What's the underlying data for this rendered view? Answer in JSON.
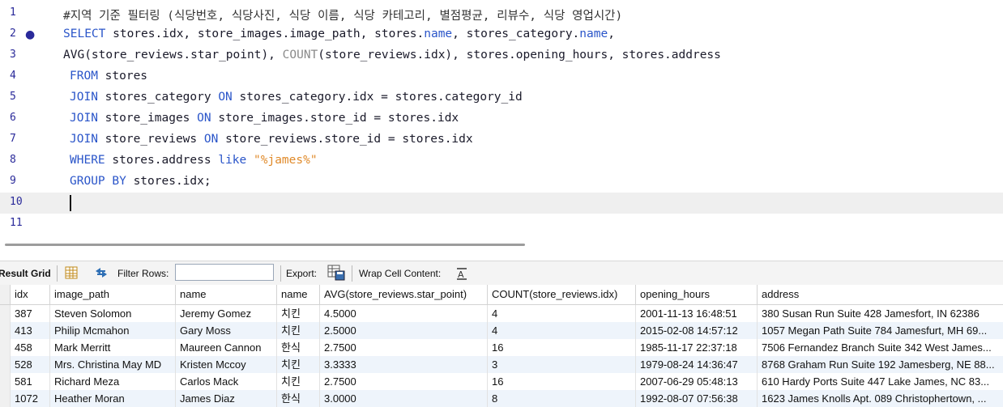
{
  "editor": {
    "lines": [
      {
        "num": "1",
        "tokens": [
          {
            "t": "#지역 기준 필터링 (식당번호, 식당사진, 식당 이름, 식당 카테고리, 별점평균, 리뷰수, 식당 영업시간)",
            "c": "cmt"
          }
        ],
        "indent": 78
      },
      {
        "num": "2",
        "tokens": [
          {
            "t": "SELECT",
            "c": "kw"
          },
          {
            "t": " stores.idx, store_images.image_path, stores.",
            "c": ""
          },
          {
            "t": "name",
            "c": "kw"
          },
          {
            "t": ", stores_category.",
            "c": ""
          },
          {
            "t": "name",
            "c": "kw"
          },
          {
            "t": ",",
            "c": ""
          }
        ],
        "indent": 78,
        "marker": "●"
      },
      {
        "num": "3",
        "tokens": [
          {
            "t": "AVG",
            "c": ""
          },
          {
            "t": "(store_reviews.star_point), ",
            "c": ""
          },
          {
            "t": "COUNT",
            "c": "fn"
          },
          {
            "t": "(store_reviews.idx), stores.opening_hours, stores.address",
            "c": ""
          }
        ],
        "indent": 78
      },
      {
        "num": "4",
        "tokens": [
          {
            "t": "FROM",
            "c": "kw"
          },
          {
            "t": " stores",
            "c": ""
          }
        ],
        "indent": 86
      },
      {
        "num": "5",
        "tokens": [
          {
            "t": "JOIN",
            "c": "kw"
          },
          {
            "t": " stores_category ",
            "c": ""
          },
          {
            "t": "ON",
            "c": "kw"
          },
          {
            "t": " stores_category.idx = stores.category_id",
            "c": ""
          }
        ],
        "indent": 86
      },
      {
        "num": "6",
        "tokens": [
          {
            "t": "JOIN",
            "c": "kw"
          },
          {
            "t": " store_images ",
            "c": ""
          },
          {
            "t": "ON",
            "c": "kw"
          },
          {
            "t": " store_images.store_id = stores.idx",
            "c": ""
          }
        ],
        "indent": 86
      },
      {
        "num": "7",
        "tokens": [
          {
            "t": "JOIN",
            "c": "kw"
          },
          {
            "t": " store_reviews ",
            "c": ""
          },
          {
            "t": "ON",
            "c": "kw"
          },
          {
            "t": " store_reviews.store_id = stores.idx",
            "c": ""
          }
        ],
        "indent": 86
      },
      {
        "num": "8",
        "tokens": [
          {
            "t": "WHERE",
            "c": "kw"
          },
          {
            "t": " stores.address ",
            "c": ""
          },
          {
            "t": "like",
            "c": "kw"
          },
          {
            "t": " ",
            "c": ""
          },
          {
            "t": "\"%james%\"",
            "c": "str"
          }
        ],
        "indent": 86
      },
      {
        "num": "9",
        "tokens": [
          {
            "t": "GROUP BY",
            "c": "kw"
          },
          {
            "t": " stores.idx;",
            "c": ""
          }
        ],
        "indent": 86
      },
      {
        "num": "10",
        "tokens": [],
        "indent": 86,
        "active": true
      },
      {
        "num": "11",
        "tokens": [],
        "indent": 86
      }
    ]
  },
  "toolbar": {
    "result_grid": "Result Grid",
    "filter_rows": "Filter Rows:",
    "filter_value": "",
    "export": "Export:",
    "wrap": "Wrap Cell Content:"
  },
  "grid": {
    "columns": [
      "idx",
      "image_path",
      "name",
      "name",
      "AVG(store_reviews.star_point)",
      "COUNT(store_reviews.idx)",
      "opening_hours",
      "address"
    ],
    "rows": [
      [
        "387",
        "Steven Solomon",
        "Jeremy Gomez",
        "치킨",
        "4.5000",
        "4",
        "2001-11-13 16:48:51",
        "380 Susan Run Suite 428 Jamesfort, IN 62386"
      ],
      [
        "413",
        "Philip Mcmahon",
        "Gary Moss",
        "치킨",
        "2.5000",
        "4",
        "2015-02-08 14:57:12",
        "1057 Megan Path Suite 784 Jamesfurt, MH 69..."
      ],
      [
        "458",
        "Mark Merritt",
        "Maureen Cannon",
        "한식",
        "2.7500",
        "16",
        "1985-11-17 22:37:18",
        "7506 Fernandez Branch Suite 342 West James..."
      ],
      [
        "528",
        "Mrs. Christina May MD",
        "Kristen Mccoy",
        "치킨",
        "3.3333",
        "3",
        "1979-08-24 14:36:47",
        "8768 Graham Run Suite 192 Jamesberg, NE 88..."
      ],
      [
        "581",
        "Richard Meza",
        "Carlos Mack",
        "치킨",
        "2.7500",
        "16",
        "2007-06-29 05:48:13",
        "610 Hardy Ports Suite 447 Lake James, NC 83..."
      ],
      [
        "1072",
        "Heather Moran",
        "James Diaz",
        "한식",
        "3.0000",
        "8",
        "1992-08-07 07:56:38",
        "1623 James Knolls Apt. 089 Christophertown, ..."
      ]
    ]
  }
}
